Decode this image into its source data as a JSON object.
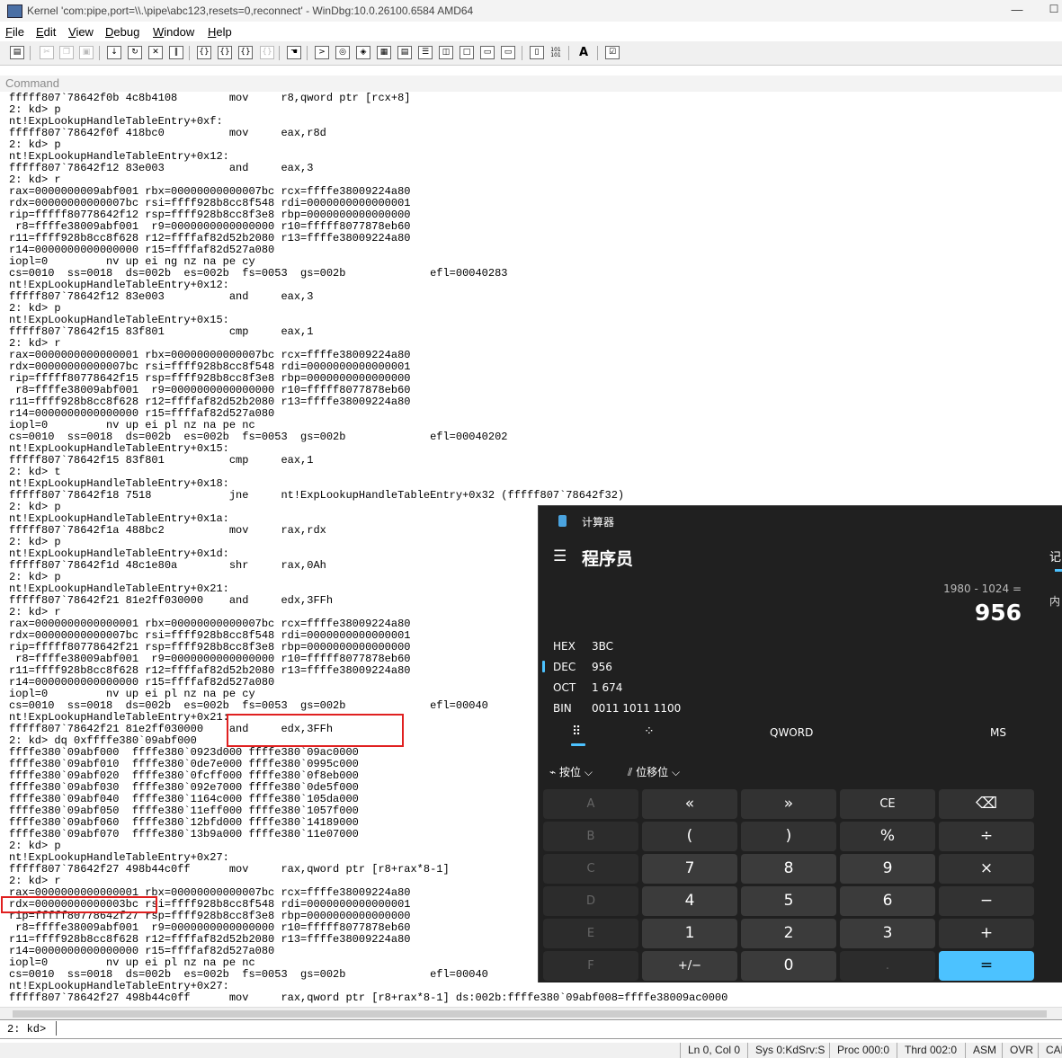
{
  "window": {
    "title": "Kernel 'com:pipe,port=\\\\.\\pipe\\abc123,resets=0,reconnect' - WinDbg:10.0.26100.6584 AMD64",
    "minimize_glyph": "—",
    "maximize_glyph": "☐"
  },
  "menu": {
    "file": {
      "key": "F",
      "rest": "ile"
    },
    "edit": {
      "key": "E",
      "rest": "dit"
    },
    "view": {
      "key": "V",
      "rest": "iew"
    },
    "debug": {
      "key": "D",
      "rest": "ebug"
    },
    "window": {
      "key": "W",
      "rest": "indow"
    },
    "help": {
      "key": "H",
      "rest": "elp"
    }
  },
  "toolbar": {
    "icons": [
      "open-icon",
      "cut-icon",
      "copy-icon",
      "paste-icon",
      "go-icon",
      "restart-icon",
      "stop-icon",
      "break-icon",
      "step-into-icon",
      "step-over-icon",
      "step-out-icon",
      "run-to-cursor-icon",
      "source-mode-icon",
      "command-window-icon",
      "watch-icon",
      "locals-icon",
      "registers-icon",
      "memory-icon",
      "call-stack-icon",
      "disassembly-icon",
      "scratch-pad-icon",
      "processes-icon",
      "source-mode-toggle-icon",
      "hex-mode-icon",
      "font-icon",
      "options-icon"
    ],
    "hex_text": "101\n101",
    "font_text": "A"
  },
  "command": {
    "header": "Command",
    "output": "fffff807`78642f0b 4c8b4108        mov     r8,qword ptr [rcx+8]\n2: kd> p\nnt!ExpLookupHandleTableEntry+0xf:\nfffff807`78642f0f 418bc0          mov     eax,r8d\n2: kd> p\nnt!ExpLookupHandleTableEntry+0x12:\nfffff807`78642f12 83e003          and     eax,3\n2: kd> r\nrax=0000000009abf001 rbx=00000000000007bc rcx=ffffe38009224a80\nrdx=00000000000007bc rsi=ffff928b8cc8f548 rdi=0000000000000001\nrip=fffff80778642f12 rsp=ffff928b8cc8f3e8 rbp=0000000000000000\n r8=ffffe38009abf001  r9=0000000000000000 r10=fffff8077878eb60\nr11=ffff928b8cc8f628 r12=ffffaf82d52b2080 r13=ffffe38009224a80\nr14=0000000000000000 r15=ffffaf82d527a080\niopl=0         nv up ei ng nz na pe cy\ncs=0010  ss=0018  ds=002b  es=002b  fs=0053  gs=002b             efl=00040283\nnt!ExpLookupHandleTableEntry+0x12:\nfffff807`78642f12 83e003          and     eax,3\n2: kd> p\nnt!ExpLookupHandleTableEntry+0x15:\nfffff807`78642f15 83f801          cmp     eax,1\n2: kd> r\nrax=0000000000000001 rbx=00000000000007bc rcx=ffffe38009224a80\nrdx=00000000000007bc rsi=ffff928b8cc8f548 rdi=0000000000000001\nrip=fffff80778642f15 rsp=ffff928b8cc8f3e8 rbp=0000000000000000\n r8=ffffe38009abf001  r9=0000000000000000 r10=fffff8077878eb60\nr11=ffff928b8cc8f628 r12=ffffaf82d52b2080 r13=ffffe38009224a80\nr14=0000000000000000 r15=ffffaf82d527a080\niopl=0         nv up ei pl nz na pe nc\ncs=0010  ss=0018  ds=002b  es=002b  fs=0053  gs=002b             efl=00040202\nnt!ExpLookupHandleTableEntry+0x15:\nfffff807`78642f15 83f801          cmp     eax,1\n2: kd> t\nnt!ExpLookupHandleTableEntry+0x18:\nfffff807`78642f18 7518            jne     nt!ExpLookupHandleTableEntry+0x32 (fffff807`78642f32)\n2: kd> p\nnt!ExpLookupHandleTableEntry+0x1a:\nfffff807`78642f1a 488bc2          mov     rax,rdx\n2: kd> p\nnt!ExpLookupHandleTableEntry+0x1d:\nfffff807`78642f1d 48c1e80a        shr     rax,0Ah\n2: kd> p\nnt!ExpLookupHandleTableEntry+0x21:\nfffff807`78642f21 81e2ff030000    and     edx,3FFh\n2: kd> r\nrax=0000000000000001 rbx=00000000000007bc rcx=ffffe38009224a80\nrdx=00000000000007bc rsi=ffff928b8cc8f548 rdi=0000000000000001\nrip=fffff80778642f21 rsp=ffff928b8cc8f3e8 rbp=0000000000000000\n r8=ffffe38009abf001  r9=0000000000000000 r10=fffff8077878eb60\nr11=ffff928b8cc8f628 r12=ffffaf82d52b2080 r13=ffffe38009224a80\nr14=0000000000000000 r15=ffffaf82d527a080\niopl=0         nv up ei pl nz na pe cy\ncs=0010  ss=0018  ds=002b  es=002b  fs=0053  gs=002b             efl=00040\nnt!ExpLookupHandleTableEntry+0x21:\nfffff807`78642f21 81e2ff030000    and     edx,3FFh\n2: kd> dq 0xffffe380`09abf000\nffffe380`09abf000  ffffe380`0923d000 ffffe380`09ac0000\nffffe380`09abf010  ffffe380`0de7e000 ffffe380`0995c000\nffffe380`09abf020  ffffe380`0fcff000 ffffe380`0f8eb000\nffffe380`09abf030  ffffe380`092e7000 ffffe380`0de5f000\nffffe380`09abf040  ffffe380`1164c000 ffffe380`105da000\nffffe380`09abf050  ffffe380`11eff000 ffffe380`1057f000\nffffe380`09abf060  ffffe380`12bfd000 ffffe380`14189000\nffffe380`09abf070  ffffe380`13b9a000 ffffe380`11e07000\n2: kd> p\nnt!ExpLookupHandleTableEntry+0x27:\nfffff807`78642f27 498b44c0ff      mov     rax,qword ptr [r8+rax*8-1]\n2: kd> r\nrax=0000000000000001 rbx=00000000000007bc rcx=ffffe38009224a80\nrdx=00000000000003bc rsi=ffff928b8cc8f548 rdi=0000000000000001\nrip=fffff80778642f27 rsp=ffff928b8cc8f3e8 rbp=0000000000000000\n r8=ffffe38009abf001  r9=0000000000000000 r10=fffff8077878eb60\nr11=ffff928b8cc8f628 r12=ffffaf82d52b2080 r13=ffffe38009224a80\nr14=0000000000000000 r15=ffffaf82d527a080\niopl=0         nv up ei pl nz na pe nc\ncs=0010  ss=0018  ds=002b  es=002b  fs=0053  gs=002b             efl=00040\nnt!ExpLookupHandleTableEntry+0x27:\nfffff807`78642f27 498b44c0ff      mov     rax,qword ptr [r8+rax*8-1] ds:002b:ffffe380`09abf008=ffffe38009ac0000",
    "prompt": "2: kd>",
    "input_value": ""
  },
  "status": {
    "ln_col": "Ln 0, Col 0",
    "sys": "Sys 0:KdSrv:S",
    "proc": "Proc 000:0",
    "thrd": "Thrd 002:0",
    "asm": "ASM",
    "ovr": "OVR",
    "caps": "CAPS"
  },
  "calculator": {
    "title": "计算器",
    "menu_glyph": "☰",
    "mode": "程序员",
    "expression": "1980 - 1024 =",
    "result": "956",
    "right_panel_tab": "记",
    "right_panel_sub": "内",
    "radix": [
      {
        "name": "HEX",
        "value": "3BC"
      },
      {
        "name": "DEC",
        "value": "956"
      },
      {
        "name": "OCT",
        "value": "1 674"
      },
      {
        "name": "BIN",
        "value": "0011 1011 1100"
      }
    ],
    "tabs": {
      "keypad_glyph": "⠿",
      "bit_glyph": "⁘",
      "word_size": "QWORD",
      "memory_store": "MS"
    },
    "dropdowns": {
      "bitwise": "按位",
      "bitshift": "位移位",
      "chevron": "⌵"
    },
    "keys": {
      "A": "A",
      "lshift": "«",
      "rshift": "»",
      "CE": "CE",
      "backspace": "⌫",
      "B": "B",
      "lparen": "(",
      "rparen": ")",
      "percent": "%",
      "divide": "÷",
      "C": "C",
      "7": "7",
      "8": "8",
      "9": "9",
      "multiply": "×",
      "D": "D",
      "4": "4",
      "5": "5",
      "6": "6",
      "minus": "−",
      "E": "E",
      "1": "1",
      "2": "2",
      "3": "3",
      "plus": "+",
      "F": "F",
      "negate": "+/−",
      "0": "0",
      "decimal": ".",
      "equals": "="
    },
    "accent_color": "#4cc2ff"
  },
  "annotations": {
    "highlight_color": "#e02020"
  }
}
